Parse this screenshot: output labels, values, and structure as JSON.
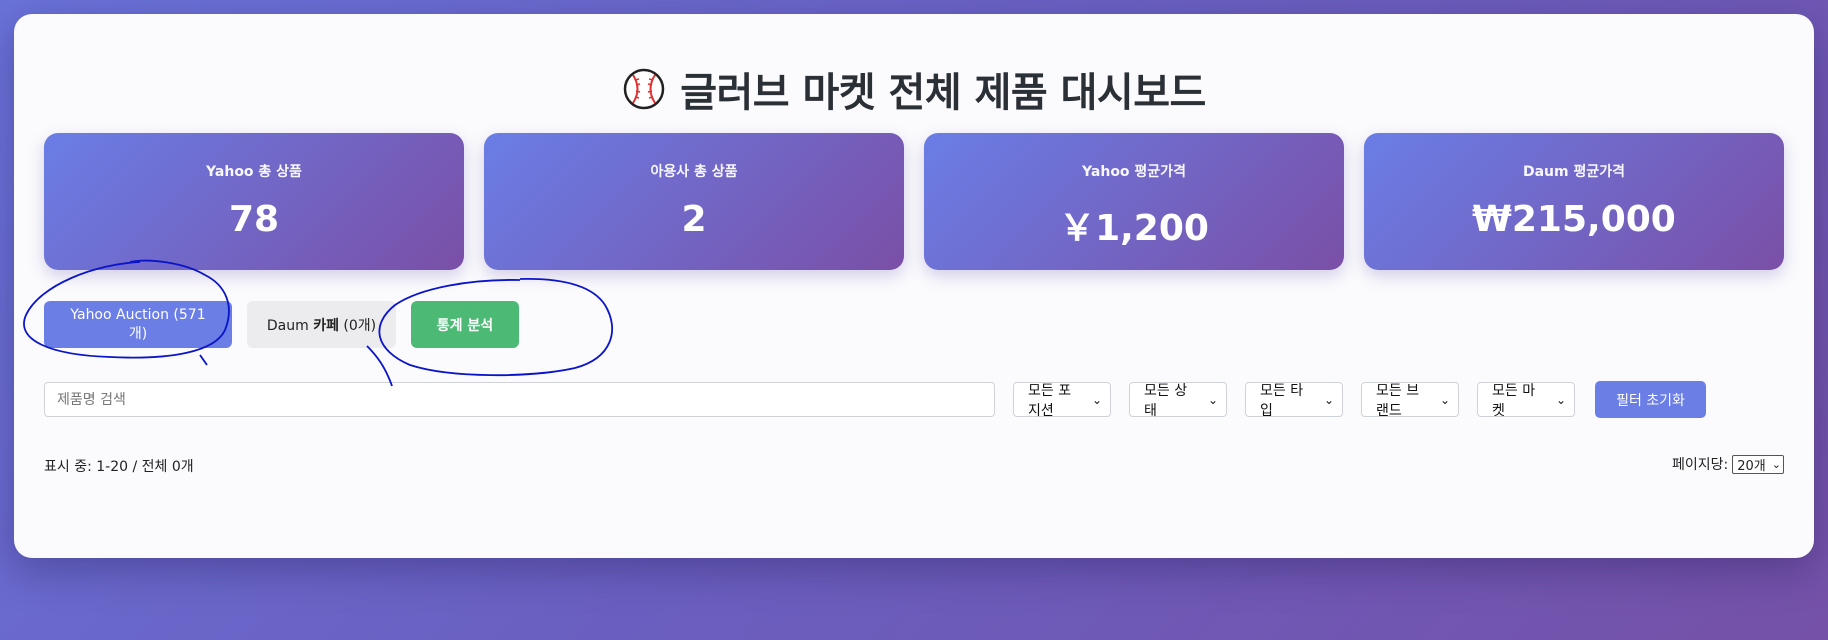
{
  "header": {
    "title": "글러브 마켓 전체 제품 대시보드",
    "icon": "baseball-icon"
  },
  "stats": [
    {
      "label": "Yahoo 총 상품",
      "value": "78"
    },
    {
      "label": "아용사 총 상품",
      "value": "2"
    },
    {
      "label": "Yahoo 평균가격",
      "value": "￥1,200"
    },
    {
      "label": "Daum 평균가격",
      "value": "₩215,000"
    }
  ],
  "tabs": {
    "yahoo": "Yahoo Auction (571개)",
    "daum_prefix": "Daum ",
    "daum_bold": "카페",
    "daum_suffix": " (0개)",
    "stats": "통계 분석"
  },
  "filters": {
    "search_placeholder": "제품명 검색",
    "position": "모든 포지션",
    "status": "모든 상태",
    "type": "모든 타입",
    "brand": "모든 브랜드",
    "market": "모든 마켓",
    "reset": "필터 초기화"
  },
  "listing": {
    "status_text": "표시 중: 1-20 / 전체 0개",
    "per_page_label": "페이지당:",
    "per_page_value": "20개"
  },
  "colors": {
    "accent": "#6a7ee6",
    "stats_button": "#4cb975",
    "annotation": "#0a14c8"
  }
}
